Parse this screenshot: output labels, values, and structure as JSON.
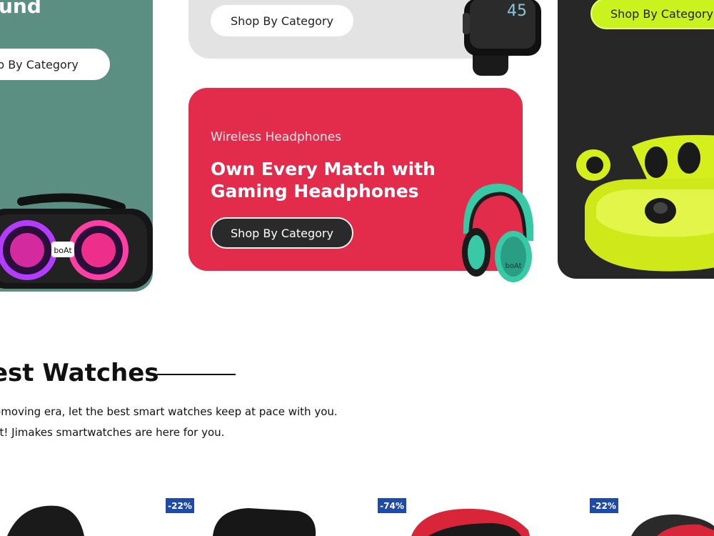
{
  "cards": {
    "green": {
      "heading_partial": "und",
      "button": "op By Category"
    },
    "gray": {
      "button": "Shop By Category",
      "watch_time": "45"
    },
    "red": {
      "subtitle": "Wireless Headphones",
      "title": "Own Every Match with Gaming Headphones",
      "button": "Shop By Category",
      "headphone_logo": "boAt"
    },
    "dark": {
      "button": "Shop By Category"
    }
  },
  "speaker_logo": "boAt",
  "section": {
    "title": "est Watches",
    "desc_line1": "t-moving era, let the best smart watches keep at pace with you.",
    "desc_line2": "ht! Jimakes smartwatches are here for you."
  },
  "products": [
    {
      "discount": "-22%"
    },
    {
      "discount": "-74%"
    },
    {
      "discount": "-22%"
    }
  ],
  "colors": {
    "green_card": "#5a8f82",
    "gray_card": "#e3e3e3",
    "red_card": "#e32b4b",
    "dark_card": "#272727",
    "lime_accent": "#c9f21e",
    "badge_blue": "#1f4aa8"
  }
}
